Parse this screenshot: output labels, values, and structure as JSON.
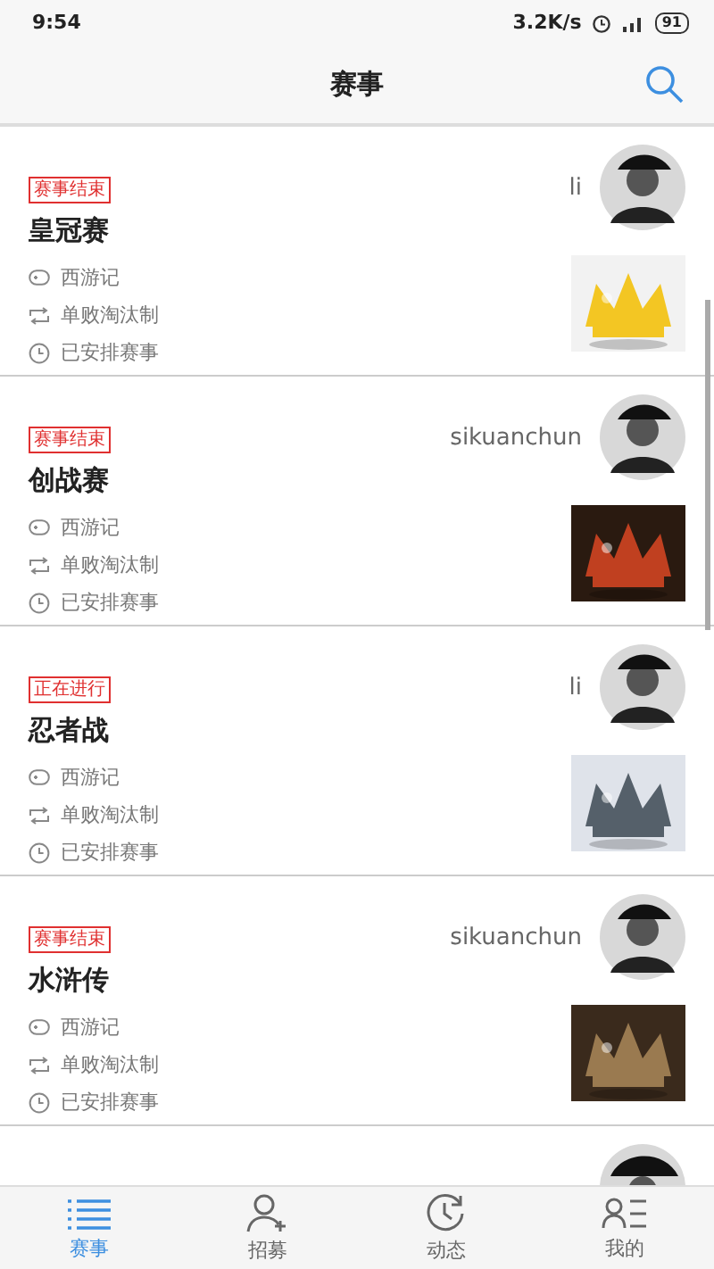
{
  "status_bar": {
    "time": "9:54",
    "speed": "3.2K/s",
    "battery": "91"
  },
  "header": {
    "title": "赛事"
  },
  "events": [
    {
      "status": "赛事结束",
      "name": "皇冠赛",
      "user": "li",
      "game": "西游记",
      "format": "单败淘汰制",
      "schedule": "已安排赛事"
    },
    {
      "status": "赛事结束",
      "name": "创战赛",
      "user": "sikuanchun",
      "game": "西游记",
      "format": "单败淘汰制",
      "schedule": "已安排赛事"
    },
    {
      "status": "正在进行",
      "name": "忍者战",
      "user": "li",
      "game": "西游记",
      "format": "单败淘汰制",
      "schedule": "已安排赛事"
    },
    {
      "status": "赛事结束",
      "name": "水浒传",
      "user": "sikuanchun",
      "game": "西游记",
      "format": "单败淘汰制",
      "schedule": "已安排赛事"
    }
  ],
  "tabs": [
    {
      "label": "赛事",
      "kind": "list",
      "selected": true
    },
    {
      "label": "招募",
      "kind": "recruit",
      "selected": false
    },
    {
      "label": "动态",
      "kind": "activity",
      "selected": false
    },
    {
      "label": "我的",
      "kind": "profile",
      "selected": false
    }
  ]
}
